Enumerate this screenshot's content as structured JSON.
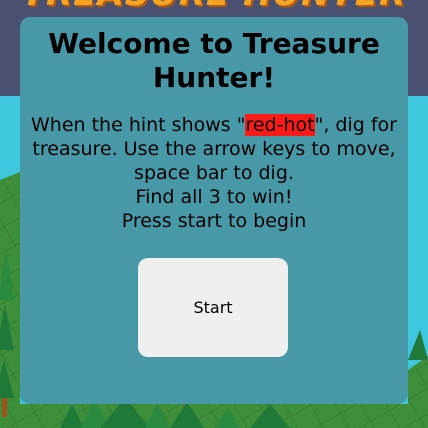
{
  "game": {
    "title": "TREASURE HUNTER"
  },
  "modal": {
    "heading": "Welcome to Treasure Hunter!",
    "instructions_pre": "When the hint shows \"",
    "hot_word": "red-hot",
    "instructions_post": "\", dig for treasure. Use the arrow keys to move, space bar to dig.",
    "goal": "Find all 3 to win!",
    "prompt": "Press start to begin",
    "start_label": "Start"
  },
  "colors": {
    "header_bg": "#4a5170",
    "sky": "#3fc6df",
    "modal_bg": "#4799a8",
    "hot_highlight": "#ff1a1a",
    "title_orange": "#f7a520",
    "grass": "#3e8f3a",
    "tree": "#1f7a3a",
    "trunk": "#a0521d"
  }
}
